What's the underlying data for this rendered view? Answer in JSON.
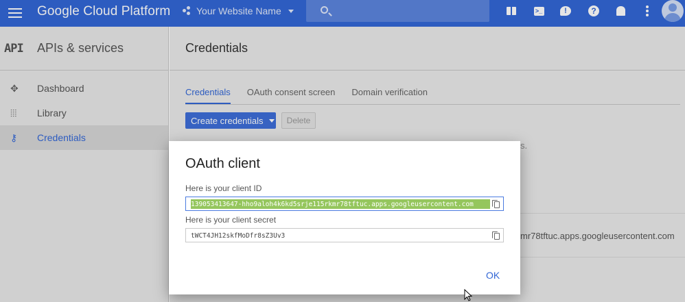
{
  "topbar": {
    "brand": "Google Cloud Platform",
    "project_name": "Your Website Name",
    "icons": [
      "menu-icon",
      "project-dots-icon",
      "search-icon",
      "gift-icon",
      "cloud-shell-icon",
      "feedback-icon",
      "help-icon",
      "notifications-icon",
      "more-vert-icon",
      "account-avatar"
    ]
  },
  "sidebar": {
    "icon_text": "API",
    "title": "APIs & services",
    "items": [
      {
        "label": "Dashboard",
        "icon": "dashboard-icon"
      },
      {
        "label": "Library",
        "icon": "library-icon"
      },
      {
        "label": "Credentials",
        "icon": "key-icon",
        "active": true
      }
    ]
  },
  "main": {
    "title": "Credentials",
    "tabs": [
      {
        "label": "Credentials",
        "active": true
      },
      {
        "label": "OAuth consent screen"
      },
      {
        "label": "Domain verification"
      }
    ],
    "create_button": "Create credentials",
    "delete_button": "Delete",
    "background_text_fragment": "s.",
    "background_client_id_fragment": "mr78tftuc.apps.googleusercontent.com"
  },
  "dialog": {
    "title": "OAuth client",
    "client_id_label": "Here is your client ID",
    "client_id_value": "139053413647-hho9aloh4k6kd5srje115rkmr78tftuc.apps.googleusercontent.com",
    "client_secret_label": "Here is your client secret",
    "client_secret_value": "tWCT4JH12skfMoDfr8sZ3Uv3",
    "ok_button": "OK"
  },
  "colors": {
    "topbar": "#3367d6",
    "accent": "#3367d6",
    "selection": "#95c65d"
  }
}
